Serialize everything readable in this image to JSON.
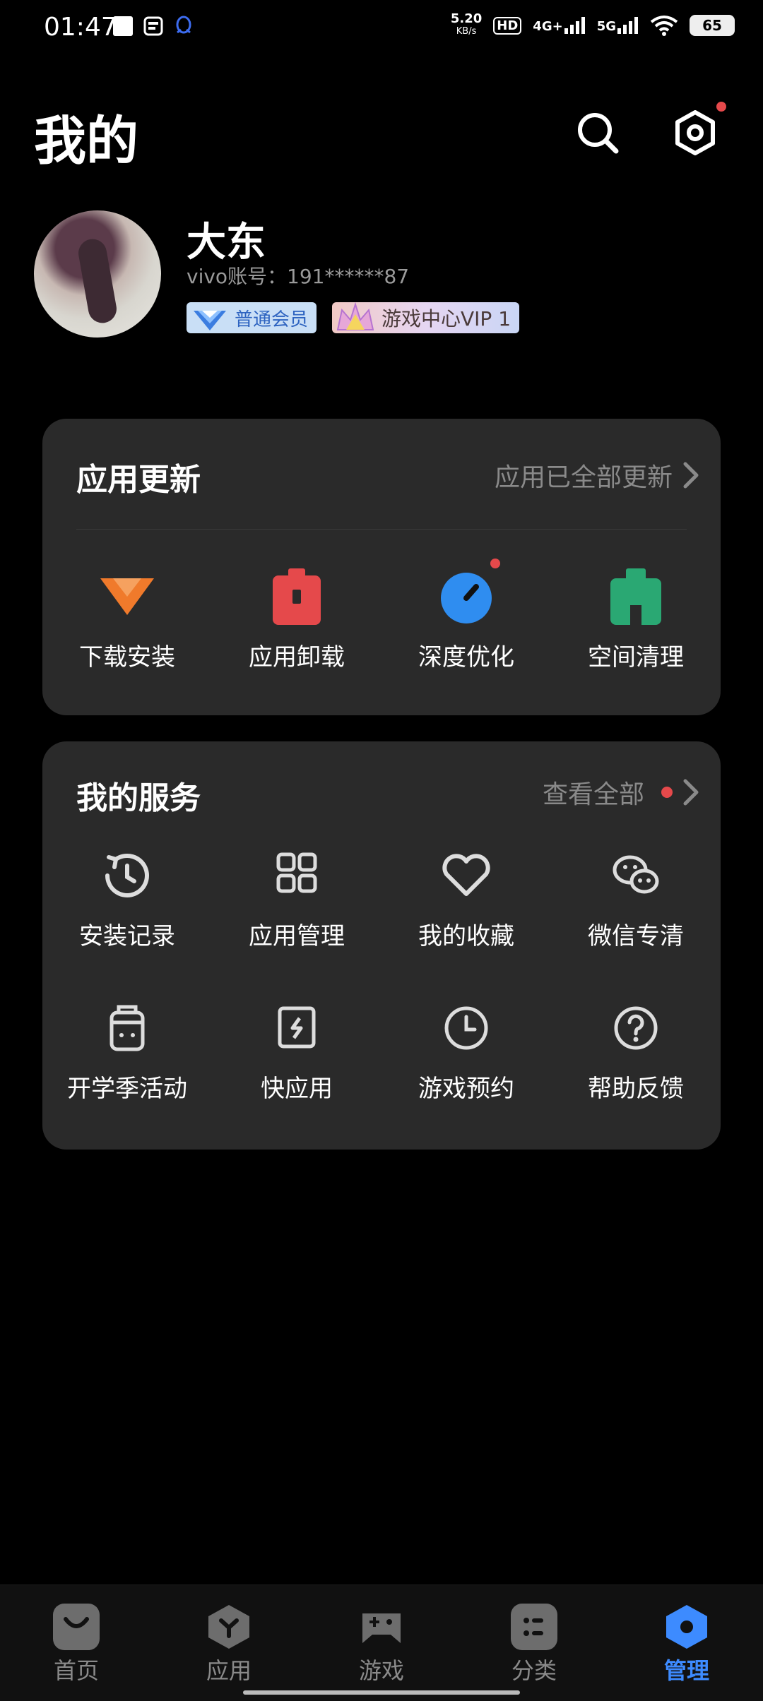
{
  "status_bar": {
    "time": "01:47",
    "net_speed": "5.20",
    "net_unit": "KB/s",
    "hd": "HD",
    "sig1": "4G+",
    "sig2": "5G",
    "battery": "65"
  },
  "header": {
    "title": "我的"
  },
  "profile": {
    "name": "大东",
    "account": "vivo账号：191******87",
    "badge_member": "普通会员",
    "badge_vip": "游戏中心VIP 1"
  },
  "app_update": {
    "title": "应用更新",
    "status": "应用已全部更新",
    "items": [
      {
        "label": "下载安装",
        "icon": "download-icon",
        "color": "#f07a2b"
      },
      {
        "label": "应用卸载",
        "icon": "trash-icon",
        "color": "#e5494b"
      },
      {
        "label": "深度优化",
        "icon": "gauge-icon",
        "color": "#2f8df0"
      },
      {
        "label": "空间清理",
        "icon": "broom-icon",
        "color": "#2aa873"
      }
    ]
  },
  "services": {
    "title": "我的服务",
    "view_all": "查看全部",
    "items": [
      {
        "label": "安装记录",
        "icon": "history-icon"
      },
      {
        "label": "应用管理",
        "icon": "grid-icon"
      },
      {
        "label": "我的收藏",
        "icon": "heart-icon"
      },
      {
        "label": "微信专清",
        "icon": "wechat-icon"
      },
      {
        "label": "开学季活动",
        "icon": "bag-icon"
      },
      {
        "label": "快应用",
        "icon": "quick-app-icon"
      },
      {
        "label": "游戏预约",
        "icon": "clock-icon"
      },
      {
        "label": "帮助反馈",
        "icon": "help-icon"
      }
    ]
  },
  "bottom_nav": [
    {
      "label": "首页",
      "icon": "home-bag-icon",
      "active": false
    },
    {
      "label": "应用",
      "icon": "apps-icon",
      "active": false
    },
    {
      "label": "游戏",
      "icon": "gamepad-icon",
      "active": false
    },
    {
      "label": "分类",
      "icon": "category-icon",
      "active": false
    },
    {
      "label": "管理",
      "icon": "manage-icon",
      "active": true
    }
  ],
  "colors": {
    "accent": "#3d8bff",
    "card_bg": "#2a2a2a",
    "badge_dot": "#e5494b"
  }
}
